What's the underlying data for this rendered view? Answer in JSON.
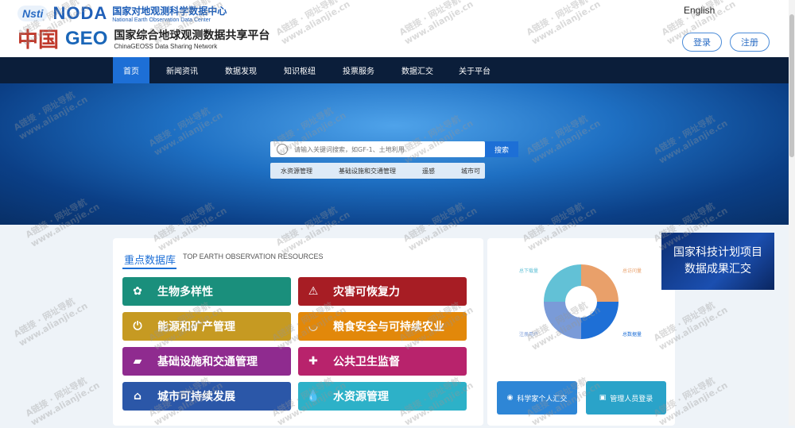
{
  "header": {
    "logo_nsti": "Nsti",
    "logo_noda": "NODA",
    "noda_cn": "国家对地观测科学数据中心",
    "noda_en": "National Earth Observation Data Center",
    "logo_zg": "中国",
    "logo_geo": "GEO",
    "platform_cn": "国家综合地球观测数据共享平台",
    "platform_en": "ChinaGEOSS Data Sharing Network",
    "lang": "English",
    "login": "登录",
    "register": "注册"
  },
  "nav": {
    "items": [
      "首页",
      "新闻资讯",
      "数据发现",
      "知识枢纽",
      "投票服务",
      "数据汇交",
      "关于平台"
    ],
    "active": "首页"
  },
  "search": {
    "placeholder": "请输入关键词搜索，如GF-1、土地利用",
    "button": "搜索",
    "tags": [
      "水资源管理",
      "基础设施和交通管理",
      "遥感",
      "城市可"
    ]
  },
  "categories": {
    "title": "重点数据库",
    "subtitle": "TOP EARTH OBSERVATION RESOURCES",
    "items": [
      {
        "label": "生物多样性",
        "color": "#1a8f7c",
        "icon": "biodiversity-icon"
      },
      {
        "label": "灾害可恢复力",
        "color": "#a71d24",
        "icon": "warning-icon"
      },
      {
        "label": "能源和矿产管理",
        "color": "#c69a22",
        "icon": "power-icon"
      },
      {
        "label": "粮食安全与可持续农业",
        "color": "#e2880a",
        "icon": "bowl-icon"
      },
      {
        "label": "基础设施和交通管理",
        "color": "#8f2b8f",
        "icon": "truck-icon"
      },
      {
        "label": "公共卫生监督",
        "color": "#b8236c",
        "icon": "health-icon"
      },
      {
        "label": "城市可持续发展",
        "color": "#2b57a8",
        "icon": "building-icon"
      },
      {
        "label": "水资源管理",
        "color": "#2db1c8",
        "icon": "water-drop-icon"
      }
    ]
  },
  "stats": {
    "pie_labels": {
      "total_visits": "总下载量",
      "visits": "总访问量",
      "datasets": "总数据量",
      "users": "注册用户"
    },
    "slice_colors": [
      "#e9a06a",
      "#1e6fd6",
      "#7a9bd8",
      "#62c1d6"
    ],
    "button_scientist": "科学家个人汇交",
    "button_admin": "管理人员登录"
  },
  "banner": {
    "line1": "国家科技计划项目",
    "line2": "数据成果汇交"
  },
  "watermark": {
    "line1": "A链接 · 网址导航",
    "line2": "www.alianjie.cn"
  }
}
